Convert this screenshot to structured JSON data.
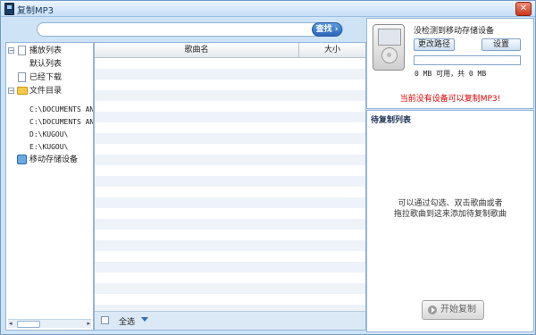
{
  "window": {
    "title": "复制MP3"
  },
  "search": {
    "value": "",
    "placeholder": "",
    "button": "查找"
  },
  "tree": {
    "items": [
      {
        "label": "播放列表",
        "expander": "−"
      },
      {
        "label": "默认列表"
      },
      {
        "label": "已经下载"
      },
      {
        "label": "文件目录",
        "expander": "−"
      },
      {
        "label": "C:\\DOCUMENTS AND"
      },
      {
        "label": "C:\\DOCUMENTS AND"
      },
      {
        "label": "D:\\KUGOU\\"
      },
      {
        "label": "E:\\KUGOU\\"
      },
      {
        "label": "移动存储设备"
      }
    ]
  },
  "song_list": {
    "columns": [
      "歌曲名",
      "大小"
    ],
    "rows": [],
    "select_all": "全选"
  },
  "device": {
    "status": "没检测到移动存储设备",
    "change_path": "更改路径",
    "settings": "设置",
    "space": "0 MB 可用，共 0 MB",
    "warning": "当前没有设备可以复制MP3!"
  },
  "queue": {
    "title": "待复制列表",
    "hint_line1": "可以通过勾选、双击歌曲或者",
    "hint_line2": "拖拉歌曲到这来添加待复制歌曲",
    "start_button": "开始复制"
  }
}
